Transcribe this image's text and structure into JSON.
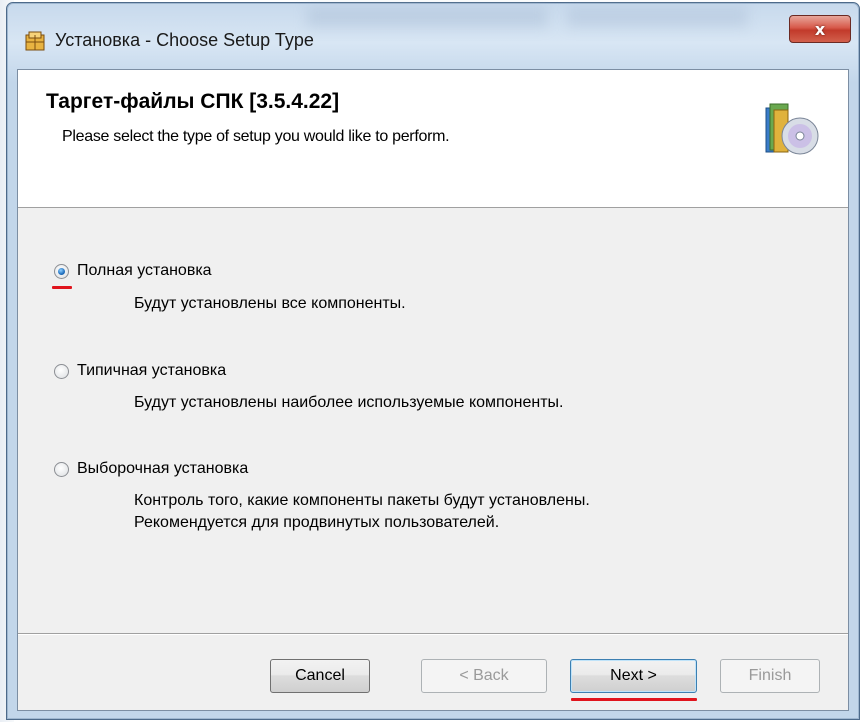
{
  "window": {
    "title": "Установка - Choose Setup Type",
    "close_glyph": "x"
  },
  "header": {
    "title": "Таргет-файлы СПК [3.5.4.22]",
    "subtitle": "Please select the type of setup you would like to perform.",
    "icon": "setup-disc-icon"
  },
  "options": [
    {
      "label": "Полная установка",
      "description": [
        "Будут установлены все компоненты."
      ],
      "selected": true
    },
    {
      "label": "Типичная установка",
      "description": [
        "Будут установлены наиболее используемые компоненты."
      ],
      "selected": false
    },
    {
      "label": "Выборочная установка",
      "description": [
        "Контроль того, какие компоненты пакеты будут установлены.",
        "Рекомендуется для продвинутых пользователей."
      ],
      "selected": false
    }
  ],
  "buttons": {
    "cancel": "Cancel",
    "back": "< Back",
    "next": "Next >",
    "finish": "Finish"
  },
  "colors": {
    "annotation_underline": "#e0141d",
    "radio_selected": "#1f6fbf"
  }
}
